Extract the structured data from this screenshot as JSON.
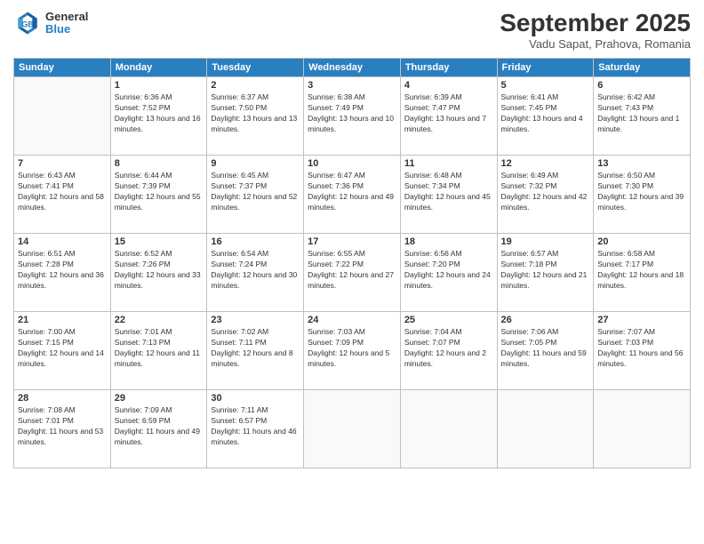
{
  "logo": {
    "line1": "General",
    "line2": "Blue"
  },
  "header": {
    "month": "September 2025",
    "location": "Vadu Sapat, Prahova, Romania"
  },
  "weekdays": [
    "Sunday",
    "Monday",
    "Tuesday",
    "Wednesday",
    "Thursday",
    "Friday",
    "Saturday"
  ],
  "weeks": [
    [
      {
        "day": "",
        "empty": true
      },
      {
        "day": "1",
        "sunrise": "Sunrise: 6:36 AM",
        "sunset": "Sunset: 7:52 PM",
        "daylight": "Daylight: 13 hours and 16 minutes."
      },
      {
        "day": "2",
        "sunrise": "Sunrise: 6:37 AM",
        "sunset": "Sunset: 7:50 PM",
        "daylight": "Daylight: 13 hours and 13 minutes."
      },
      {
        "day": "3",
        "sunrise": "Sunrise: 6:38 AM",
        "sunset": "Sunset: 7:49 PM",
        "daylight": "Daylight: 13 hours and 10 minutes."
      },
      {
        "day": "4",
        "sunrise": "Sunrise: 6:39 AM",
        "sunset": "Sunset: 7:47 PM",
        "daylight": "Daylight: 13 hours and 7 minutes."
      },
      {
        "day": "5",
        "sunrise": "Sunrise: 6:41 AM",
        "sunset": "Sunset: 7:45 PM",
        "daylight": "Daylight: 13 hours and 4 minutes."
      },
      {
        "day": "6",
        "sunrise": "Sunrise: 6:42 AM",
        "sunset": "Sunset: 7:43 PM",
        "daylight": "Daylight: 13 hours and 1 minute."
      }
    ],
    [
      {
        "day": "7",
        "sunrise": "Sunrise: 6:43 AM",
        "sunset": "Sunset: 7:41 PM",
        "daylight": "Daylight: 12 hours and 58 minutes."
      },
      {
        "day": "8",
        "sunrise": "Sunrise: 6:44 AM",
        "sunset": "Sunset: 7:39 PM",
        "daylight": "Daylight: 12 hours and 55 minutes."
      },
      {
        "day": "9",
        "sunrise": "Sunrise: 6:45 AM",
        "sunset": "Sunset: 7:37 PM",
        "daylight": "Daylight: 12 hours and 52 minutes."
      },
      {
        "day": "10",
        "sunrise": "Sunrise: 6:47 AM",
        "sunset": "Sunset: 7:36 PM",
        "daylight": "Daylight: 12 hours and 49 minutes."
      },
      {
        "day": "11",
        "sunrise": "Sunrise: 6:48 AM",
        "sunset": "Sunset: 7:34 PM",
        "daylight": "Daylight: 12 hours and 45 minutes."
      },
      {
        "day": "12",
        "sunrise": "Sunrise: 6:49 AM",
        "sunset": "Sunset: 7:32 PM",
        "daylight": "Daylight: 12 hours and 42 minutes."
      },
      {
        "day": "13",
        "sunrise": "Sunrise: 6:50 AM",
        "sunset": "Sunset: 7:30 PM",
        "daylight": "Daylight: 12 hours and 39 minutes."
      }
    ],
    [
      {
        "day": "14",
        "sunrise": "Sunrise: 6:51 AM",
        "sunset": "Sunset: 7:28 PM",
        "daylight": "Daylight: 12 hours and 36 minutes."
      },
      {
        "day": "15",
        "sunrise": "Sunrise: 6:52 AM",
        "sunset": "Sunset: 7:26 PM",
        "daylight": "Daylight: 12 hours and 33 minutes."
      },
      {
        "day": "16",
        "sunrise": "Sunrise: 6:54 AM",
        "sunset": "Sunset: 7:24 PM",
        "daylight": "Daylight: 12 hours and 30 minutes."
      },
      {
        "day": "17",
        "sunrise": "Sunrise: 6:55 AM",
        "sunset": "Sunset: 7:22 PM",
        "daylight": "Daylight: 12 hours and 27 minutes."
      },
      {
        "day": "18",
        "sunrise": "Sunrise: 6:56 AM",
        "sunset": "Sunset: 7:20 PM",
        "daylight": "Daylight: 12 hours and 24 minutes."
      },
      {
        "day": "19",
        "sunrise": "Sunrise: 6:57 AM",
        "sunset": "Sunset: 7:18 PM",
        "daylight": "Daylight: 12 hours and 21 minutes."
      },
      {
        "day": "20",
        "sunrise": "Sunrise: 6:58 AM",
        "sunset": "Sunset: 7:17 PM",
        "daylight": "Daylight: 12 hours and 18 minutes."
      }
    ],
    [
      {
        "day": "21",
        "sunrise": "Sunrise: 7:00 AM",
        "sunset": "Sunset: 7:15 PM",
        "daylight": "Daylight: 12 hours and 14 minutes."
      },
      {
        "day": "22",
        "sunrise": "Sunrise: 7:01 AM",
        "sunset": "Sunset: 7:13 PM",
        "daylight": "Daylight: 12 hours and 11 minutes."
      },
      {
        "day": "23",
        "sunrise": "Sunrise: 7:02 AM",
        "sunset": "Sunset: 7:11 PM",
        "daylight": "Daylight: 12 hours and 8 minutes."
      },
      {
        "day": "24",
        "sunrise": "Sunrise: 7:03 AM",
        "sunset": "Sunset: 7:09 PM",
        "daylight": "Daylight: 12 hours and 5 minutes."
      },
      {
        "day": "25",
        "sunrise": "Sunrise: 7:04 AM",
        "sunset": "Sunset: 7:07 PM",
        "daylight": "Daylight: 12 hours and 2 minutes."
      },
      {
        "day": "26",
        "sunrise": "Sunrise: 7:06 AM",
        "sunset": "Sunset: 7:05 PM",
        "daylight": "Daylight: 11 hours and 59 minutes."
      },
      {
        "day": "27",
        "sunrise": "Sunrise: 7:07 AM",
        "sunset": "Sunset: 7:03 PM",
        "daylight": "Daylight: 11 hours and 56 minutes."
      }
    ],
    [
      {
        "day": "28",
        "sunrise": "Sunrise: 7:08 AM",
        "sunset": "Sunset: 7:01 PM",
        "daylight": "Daylight: 11 hours and 53 minutes."
      },
      {
        "day": "29",
        "sunrise": "Sunrise: 7:09 AM",
        "sunset": "Sunset: 6:59 PM",
        "daylight": "Daylight: 11 hours and 49 minutes."
      },
      {
        "day": "30",
        "sunrise": "Sunrise: 7:11 AM",
        "sunset": "Sunset: 6:57 PM",
        "daylight": "Daylight: 11 hours and 46 minutes."
      },
      {
        "day": "",
        "empty": true
      },
      {
        "day": "",
        "empty": true
      },
      {
        "day": "",
        "empty": true
      },
      {
        "day": "",
        "empty": true
      }
    ]
  ]
}
